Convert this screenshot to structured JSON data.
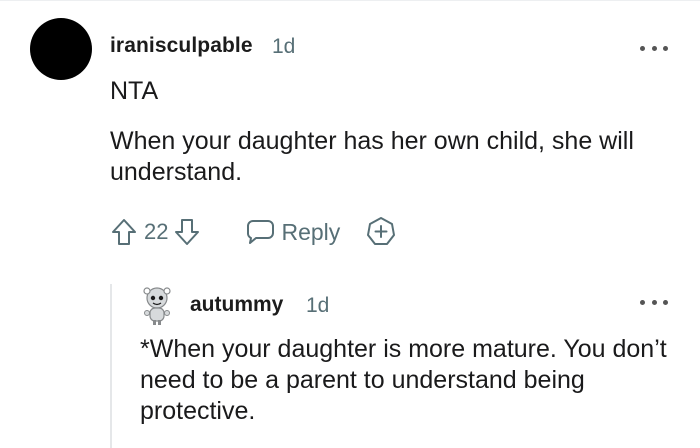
{
  "comment": {
    "username": "iranisculpable",
    "age": "1d",
    "verdict": "NTA",
    "body": "When your daughter has her own child, she will understand.",
    "score": "22",
    "reply_label": "Reply"
  },
  "reply": {
    "username": "autummy",
    "age": "1d",
    "body": "*When your daughter is more mature. You don’t need to be a parent to understand being protective."
  },
  "icons": {
    "avatar_main": "black-circle-avatar",
    "avatar_reply": "snoo-avatar",
    "upvote": "upvote-arrow-icon",
    "downvote": "downvote-arrow-icon",
    "reply": "speech-bubble-icon",
    "award": "award-plus-icon",
    "more": "more-options-icon"
  },
  "colors": {
    "text": "#1a1a1b",
    "meta": "#576f76",
    "thread_line": "#e5e7e9"
  }
}
